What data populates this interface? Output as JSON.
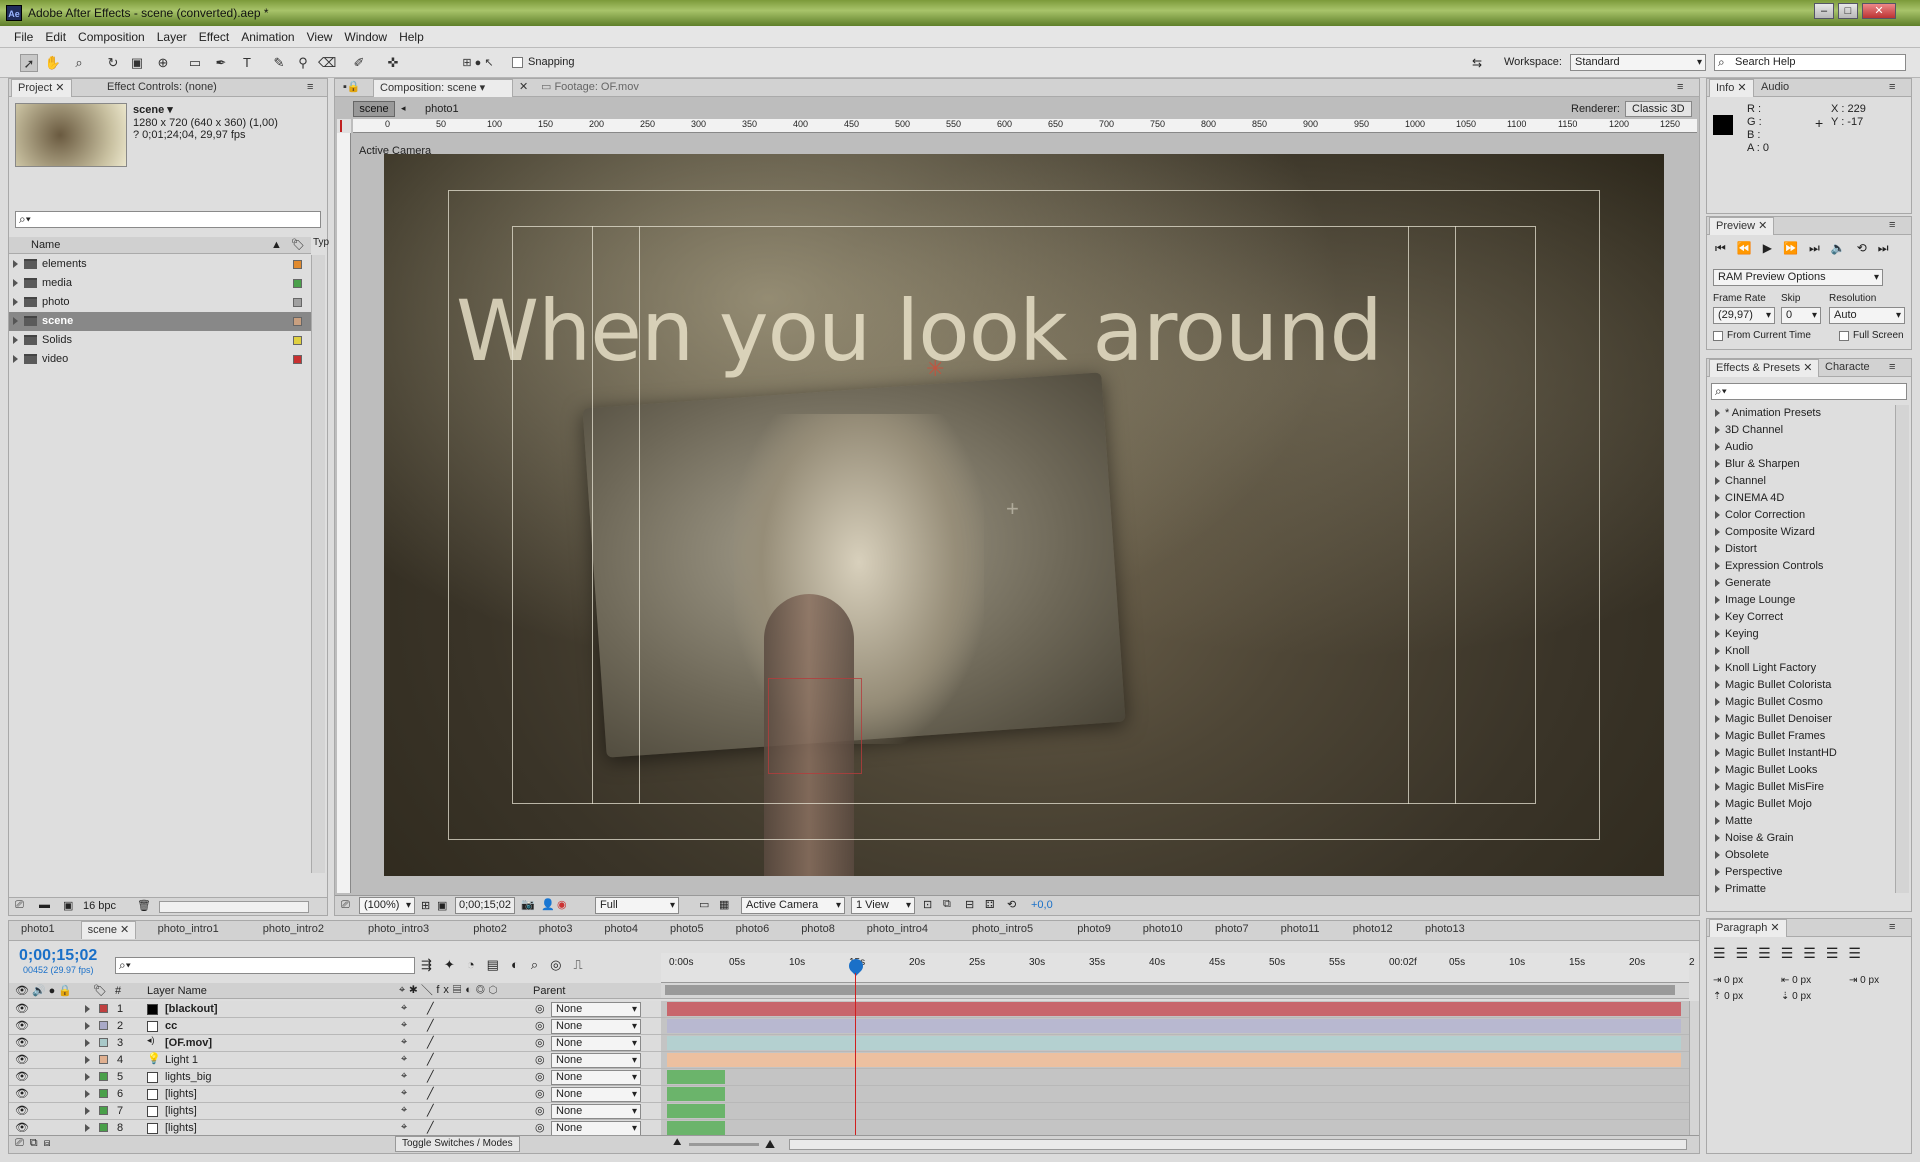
{
  "window": {
    "title": "Adobe After Effects - scene (converted).aep *",
    "app_icon": "Ae"
  },
  "menu": [
    "File",
    "Edit",
    "Composition",
    "Layer",
    "Effect",
    "Animation",
    "View",
    "Window",
    "Help"
  ],
  "toolbar": {
    "snapping": "Snapping",
    "workspace_label": "Workspace:",
    "workspace_value": "Standard",
    "search_placeholder": "Search Help"
  },
  "project": {
    "tab": "Project",
    "effect_controls_tab": "Effect Controls: (none)",
    "comp_name": "scene ▾",
    "comp_size": "1280 x 720  (640 x 360) (1,00)",
    "comp_duration": "? 0;01;24;04, 29,97 fps",
    "col_name": "Name",
    "col_type": "Typ",
    "bpc": "16 bpc",
    "items": [
      {
        "name": "elements",
        "color": "#e08a2e"
      },
      {
        "name": "media",
        "color": "#4aa04a"
      },
      {
        "name": "photo",
        "color": "#a0a0a0"
      },
      {
        "name": "scene",
        "color": "#c9a080",
        "selected": true
      },
      {
        "name": "Solids",
        "color": "#e0d040"
      },
      {
        "name": "video",
        "color": "#c83030"
      }
    ]
  },
  "composition": {
    "tab": "Composition: scene",
    "footage_tab": "Footage: OF.mov",
    "breadcrumb_active": "scene",
    "breadcrumb_next": "photo1",
    "renderer_label": "Renderer:",
    "renderer_value": "Classic 3D",
    "camera_label": "Active Camera",
    "title_text": "When you look around",
    "ruler_labels": [
      "0",
      "50",
      "100",
      "150",
      "200",
      "250",
      "300",
      "350",
      "400",
      "450",
      "500",
      "550",
      "600",
      "650",
      "700",
      "750",
      "800",
      "850",
      "900",
      "950",
      "1000",
      "1050",
      "1100",
      "1150",
      "1200",
      "1250"
    ],
    "bottom": {
      "zoom": "(100%)",
      "timecode": "0;00;15;02",
      "quality": "Full",
      "view": "Active Camera",
      "views": "1 View",
      "exposure": "+0,0"
    }
  },
  "info": {
    "tab": "Info",
    "audio_tab": "Audio",
    "r": "R :",
    "g": "G :",
    "b": "B :",
    "a": "A :  0",
    "x": "X : 229",
    "y": "Y : -17"
  },
  "preview": {
    "tab": "Preview",
    "ram_options": "RAM Preview Options",
    "frame_rate_label": "Frame Rate",
    "skip_label": "Skip",
    "resolution_label": "Resolution",
    "frame_rate": "(29,97)",
    "skip": "0",
    "resolution": "Auto",
    "from_current": "From Current Time",
    "full_screen": "Full Screen"
  },
  "effects": {
    "tab": "Effects & Presets",
    "character_tab": "Characte",
    "items": [
      "* Animation Presets",
      "3D Channel",
      "Audio",
      "Blur & Sharpen",
      "Channel",
      "CINEMA 4D",
      "Color Correction",
      "Composite Wizard",
      "Distort",
      "Expression Controls",
      "Generate",
      "Image Lounge",
      "Key Correct",
      "Keying",
      "Knoll",
      "Knoll Light Factory",
      "Magic Bullet Colorista",
      "Magic Bullet Cosmo",
      "Magic Bullet Denoiser",
      "Magic Bullet Frames",
      "Magic Bullet InstantHD",
      "Magic Bullet Looks",
      "Magic Bullet MisFire",
      "Magic Bullet Mojo",
      "Matte",
      "Noise & Grain",
      "Obsolete",
      "Perspective",
      "Primatte"
    ]
  },
  "paragraph": {
    "tab": "Paragraph",
    "values": [
      "0 px",
      "0 px",
      "0 px",
      "0 px",
      "0 px"
    ]
  },
  "timeline": {
    "tabs": [
      "photo1",
      "scene",
      "photo_intro1",
      "photo_intro2",
      "photo_intro3",
      "photo2",
      "photo3",
      "photo4",
      "photo5",
      "photo6",
      "photo8",
      "photo_intro4",
      "photo_intro5",
      "photo9",
      "photo10",
      "photo7",
      "photo11",
      "photo12",
      "photo13"
    ],
    "active_tab": "scene",
    "timecode": "0;00;15;02",
    "frames": "00452 (29.97 fps)",
    "col_layer": "Layer Name",
    "col_parent": "Parent",
    "col_num": "#",
    "toggle": "Toggle Switches / Modes",
    "ruler": [
      "0:00s",
      "05s",
      "10s",
      "15s",
      "20s",
      "25s",
      "30s",
      "35s",
      "40s",
      "45s",
      "50s",
      "55s",
      "00:02f",
      "05s",
      "10s",
      "15s",
      "20s",
      "2"
    ],
    "layers": [
      {
        "num": "1",
        "name": "[blackout]",
        "color": "#c04040",
        "bar": "#c8666c",
        "swatch": "#000000",
        "parent": "None",
        "full": true
      },
      {
        "num": "2",
        "name": "cc",
        "color": "#a9a9c8",
        "bar": "#b8b8d0",
        "swatch": "#ffffff",
        "parent": "None",
        "full": true
      },
      {
        "num": "3",
        "name": "[OF.mov]",
        "color": "#a8c8c8",
        "bar": "#b4d0d0",
        "swatch": "",
        "parent": "None",
        "full": true
      },
      {
        "num": "4",
        "name": "Light 1",
        "color": "#e0b090",
        "bar": "#ecc0a0",
        "swatch": "",
        "parent": "None",
        "full": true
      },
      {
        "num": "5",
        "name": "lights_big",
        "color": "#4aa04a",
        "bar": "#6bb46b",
        "swatch": "#ffffff",
        "parent": "None",
        "full": false
      },
      {
        "num": "6",
        "name": "[lights]",
        "color": "#4aa04a",
        "bar": "#6bb46b",
        "swatch": "#ffffff",
        "parent": "None",
        "full": false
      },
      {
        "num": "7",
        "name": "[lights]",
        "color": "#4aa04a",
        "bar": "#6bb46b",
        "swatch": "#ffffff",
        "parent": "None",
        "full": false
      },
      {
        "num": "8",
        "name": "[lights]",
        "color": "#4aa04a",
        "bar": "#6bb46b",
        "swatch": "#ffffff",
        "parent": "None",
        "full": false
      }
    ]
  },
  "accent": "#1a70c8"
}
